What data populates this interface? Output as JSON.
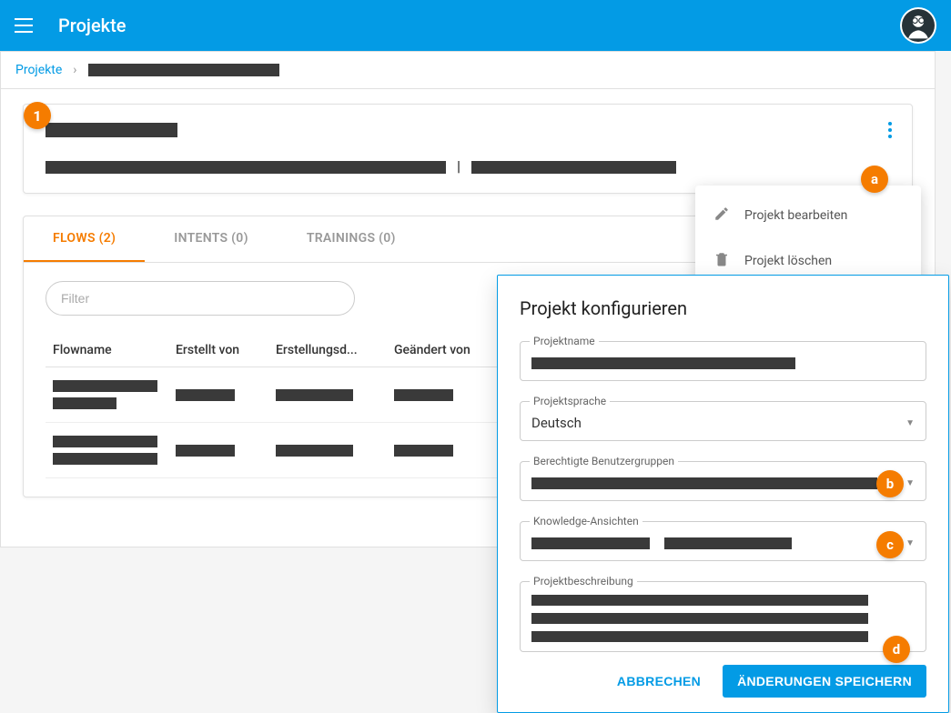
{
  "header": {
    "title": "Projekte"
  },
  "breadcrumb": {
    "root": "Projekte"
  },
  "tabs": {
    "flows": "FLOWS (2)",
    "intents": "INTENTS (0)",
    "trainings": "TRAININGS (0)"
  },
  "filter": {
    "placeholder": "Filter"
  },
  "table": {
    "cols": {
      "c0": "Flowname",
      "c1": "Erstellt von",
      "c2": "Erstellungsd...",
      "c3": "Geändert von"
    }
  },
  "popup": {
    "edit": "Projekt bearbeiten",
    "delete": "Projekt löschen"
  },
  "dialog": {
    "title": "Projekt konfigurieren",
    "fields": {
      "name": "Projektname",
      "lang": "Projektsprache",
      "lang_value": "Deutsch",
      "groups": "Berechtigte Benutzergruppen",
      "views": "Knowledge-Ansichten",
      "desc": "Projektbeschreibung"
    },
    "actions": {
      "cancel": "ABBRECHEN",
      "save": "ÄNDERUNGEN SPEICHERN"
    }
  },
  "balloons": {
    "b1": "1",
    "ba": "a",
    "bb": "b",
    "bc": "c",
    "bd": "d"
  }
}
